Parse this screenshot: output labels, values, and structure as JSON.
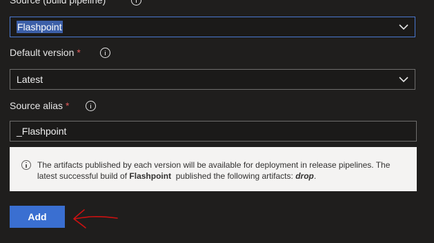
{
  "source": {
    "label": "Source (build pipeline)",
    "value": "Flashpoint"
  },
  "default_version": {
    "label": "Default version",
    "required_mark": "*",
    "value": "Latest"
  },
  "source_alias": {
    "label": "Source alias",
    "required_mark": "*",
    "value": "_Flashpoint"
  },
  "info_box": {
    "text_part1": "The artifacts published by each version will be available for deployment in release pipelines. The latest successful build of ",
    "pipeline_name": "Flashpoint",
    "text_part2": "  published the following artifacts: ",
    "artifact": "drop",
    "text_end": "."
  },
  "add_button": {
    "label": "Add"
  },
  "icons": {
    "info": "info-icon",
    "chevron": "chevron-down-icon",
    "annotation": "red-arrow-annotation"
  },
  "colors": {
    "background": "#1f1e1d",
    "accent": "#3a6fd1",
    "focus_border": "#4a78d0",
    "required": "#e05a5a",
    "annotation": "#cc1111"
  }
}
